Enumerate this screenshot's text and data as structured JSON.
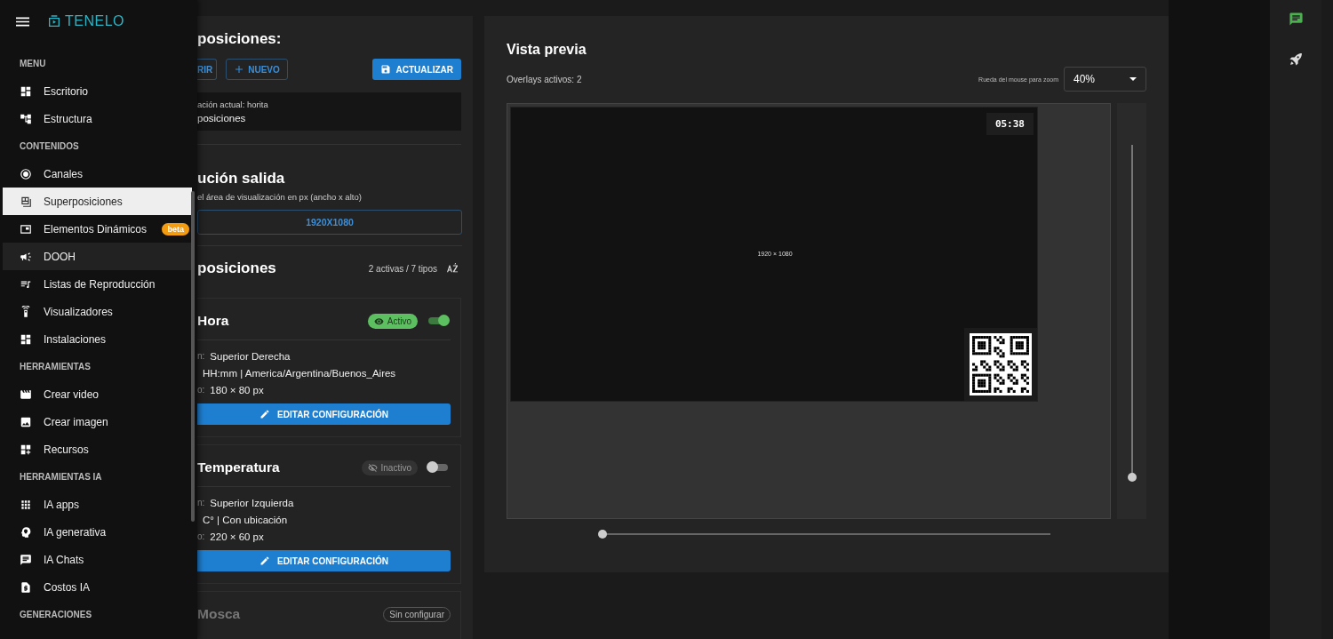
{
  "sidebar": {
    "brand": "TENELO",
    "sections": [
      {
        "title": "MENU",
        "items": [
          {
            "label": "Escritorio",
            "selected": false,
            "hovered": false
          },
          {
            "label": "Estructura",
            "selected": false,
            "hovered": false
          }
        ]
      },
      {
        "title": "CONTENIDOS",
        "items": [
          {
            "label": "Canales",
            "selected": false,
            "hovered": false
          },
          {
            "label": "Superposiciones",
            "selected": true,
            "hovered": false
          },
          {
            "label": "Elementos Dinámicos",
            "selected": false,
            "hovered": false,
            "badge": "beta"
          },
          {
            "label": "DOOH",
            "selected": false,
            "hovered": true
          },
          {
            "label": "Listas de Reproducción",
            "selected": false,
            "hovered": false
          },
          {
            "label": "Visualizadores",
            "selected": false,
            "hovered": false
          },
          {
            "label": "Instalaciones",
            "selected": false,
            "hovered": false
          }
        ]
      },
      {
        "title": "HERRAMIENTAS",
        "items": [
          {
            "label": "Crear video",
            "selected": false,
            "hovered": false
          },
          {
            "label": "Crear imagen",
            "selected": false,
            "hovered": false
          },
          {
            "label": "Recursos",
            "selected": false,
            "hovered": false
          }
        ]
      },
      {
        "title": "HERRAMIENTAS IA",
        "items": [
          {
            "label": "IA apps",
            "selected": false,
            "hovered": false
          },
          {
            "label": "IA generativa",
            "selected": false,
            "hovered": false
          },
          {
            "label": "IA Chats",
            "selected": false,
            "hovered": false
          },
          {
            "label": "Costos IA",
            "selected": false,
            "hovered": false
          }
        ]
      },
      {
        "title": "GENERACIONES"
      }
    ]
  },
  "editor": {
    "title": "posiciones:",
    "buttons": {
      "open": "RIR",
      "new": "NUEVO",
      "save": "ACTUALIZAR"
    },
    "current": {
      "line_1": "ación actual: horita",
      "line_2": "posiciones"
    },
    "resolution": {
      "title": "ución salida",
      "subtitle": "el área de visualización en px (ancho x alto)",
      "value": "1920X1080"
    },
    "overlays": {
      "title": "posiciones",
      "summary": "2 activas / 7 tipos",
      "cards": [
        {
          "kind": "configured",
          "name": "Hora",
          "status": "Activo",
          "active": true,
          "rows": [
            {
              "label": "n:",
              "value": "Superior Derecha"
            },
            {
              "value": "HH:mm | America/Argentina/Buenos_Aires"
            },
            {
              "label": "o:",
              "value": "180 × 80 px"
            }
          ],
          "edit_label": "EDITAR CONFIGURACIÓN"
        },
        {
          "kind": "configured",
          "name": "Temperatura",
          "status": "Inactivo",
          "active": false,
          "rows": [
            {
              "label": "n:",
              "value": "Superior Izquierda"
            },
            {
              "value": "C° | Con ubicación"
            },
            {
              "label": "o:",
              "value": "220 × 60 px"
            }
          ],
          "edit_label": "EDITAR CONFIGURACIÓN"
        },
        {
          "kind": "unconfigured",
          "name": "Mosca",
          "status": "Sin configurar"
        }
      ]
    }
  },
  "preview": {
    "title": "Vista previa",
    "active_count": "Overlays activos: 2",
    "zoom_hint": "Rueda del mouse para zoom",
    "zoom": "40%",
    "screen_label": "1920 × 1080",
    "clock": "05:38",
    "vertical_slider": {
      "level": 0
    },
    "horizontal_slider": {
      "level": 0
    }
  }
}
